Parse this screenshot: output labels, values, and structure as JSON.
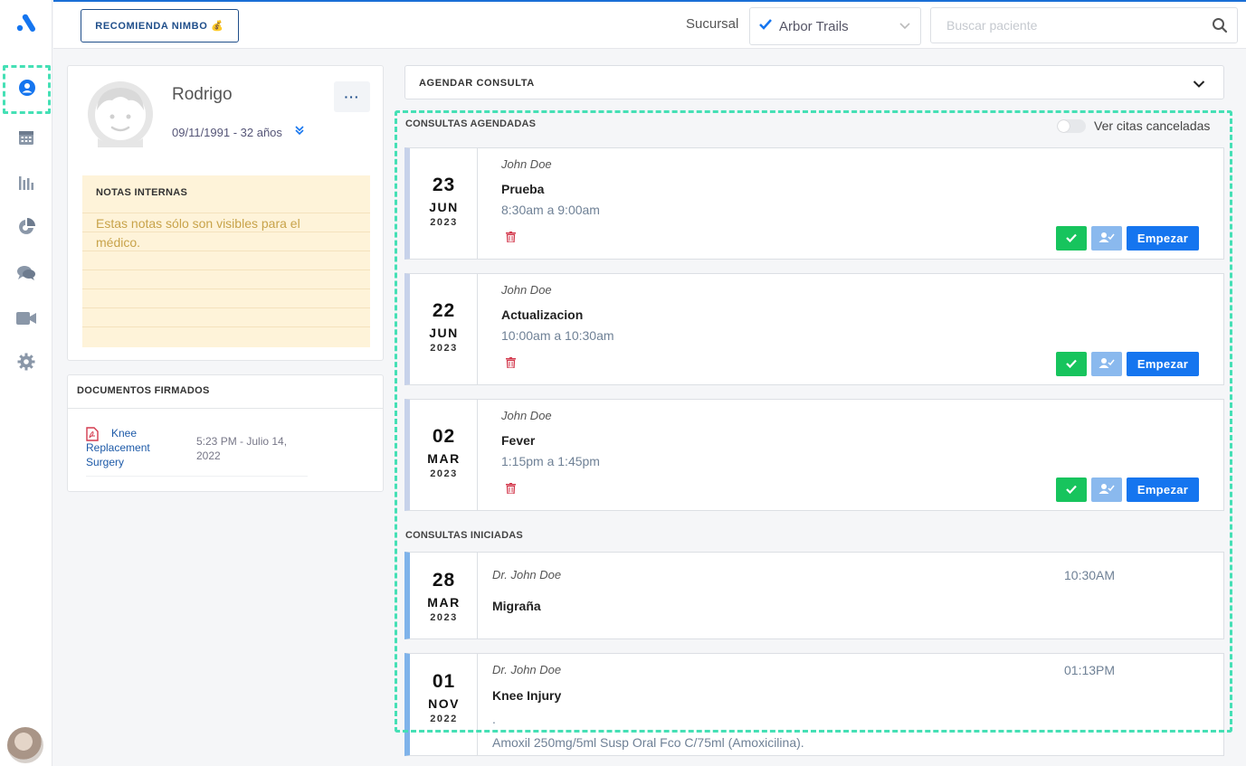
{
  "topbar": {
    "recommend_label": "RECOMIENDA NIMBO",
    "recommend_emoji": "💰",
    "branch_label": "Sucursal",
    "branch_value": "Arbor Trails",
    "search_placeholder": "Buscar paciente"
  },
  "sidebar": {
    "items": [
      {
        "icon": "patient-icon",
        "active": true
      },
      {
        "icon": "calendar-icon"
      },
      {
        "icon": "bar-chart-icon"
      },
      {
        "icon": "analytics-icon"
      },
      {
        "icon": "chat-icon"
      },
      {
        "icon": "video-icon"
      },
      {
        "icon": "gear-icon"
      }
    ]
  },
  "patient": {
    "name": "Rodrigo",
    "dob_age": "09/11/1991 - 32 años",
    "more_label": "···"
  },
  "notes": {
    "title": "NOTAS INTERNAS",
    "text": "Estas notas sólo son visibles para el médico."
  },
  "documents": {
    "title": "DOCUMENTOS FIRMADOS",
    "items": [
      {
        "name": "Knee Replacement Surgery",
        "date": "5:23 PM - Julio 14, 2022"
      }
    ]
  },
  "schedule": {
    "label": "AGENDAR CONSULTA"
  },
  "scheduled": {
    "title": "CONSULTAS AGENDADAS",
    "toggle_label": "Ver citas canceladas",
    "start_label": "Empezar",
    "items": [
      {
        "day": "23",
        "month": "JUN",
        "year": "2023",
        "doctor": "John Doe",
        "title": "Prueba",
        "time": "8:30am a 9:00am"
      },
      {
        "day": "22",
        "month": "JUN",
        "year": "2023",
        "doctor": "John Doe",
        "title": "Actualizacion",
        "time": "10:00am a 10:30am"
      },
      {
        "day": "02",
        "month": "MAR",
        "year": "2023",
        "doctor": "John Doe",
        "title": "Fever",
        "time": "1:15pm a 1:45pm"
      }
    ]
  },
  "started": {
    "title": "CONSULTAS INICIADAS",
    "items": [
      {
        "day": "28",
        "month": "MAR",
        "year": "2023",
        "doctor": "Dr. John Doe",
        "title": "Migraña",
        "time": "10:30AM"
      },
      {
        "day": "01",
        "month": "NOV",
        "year": "2022",
        "doctor": "Dr. John Doe",
        "title": "Knee Injury",
        "time": "01:13PM",
        "dot": ".",
        "note": "Amoxil 250mg/5ml Susp Oral Fco C/75ml (Amoxicilina)."
      }
    ]
  },
  "colors": {
    "primary": "#1575ef",
    "success": "#17c45d",
    "highlight": "#45e0b5",
    "notes_bg": "#fef3d9"
  }
}
